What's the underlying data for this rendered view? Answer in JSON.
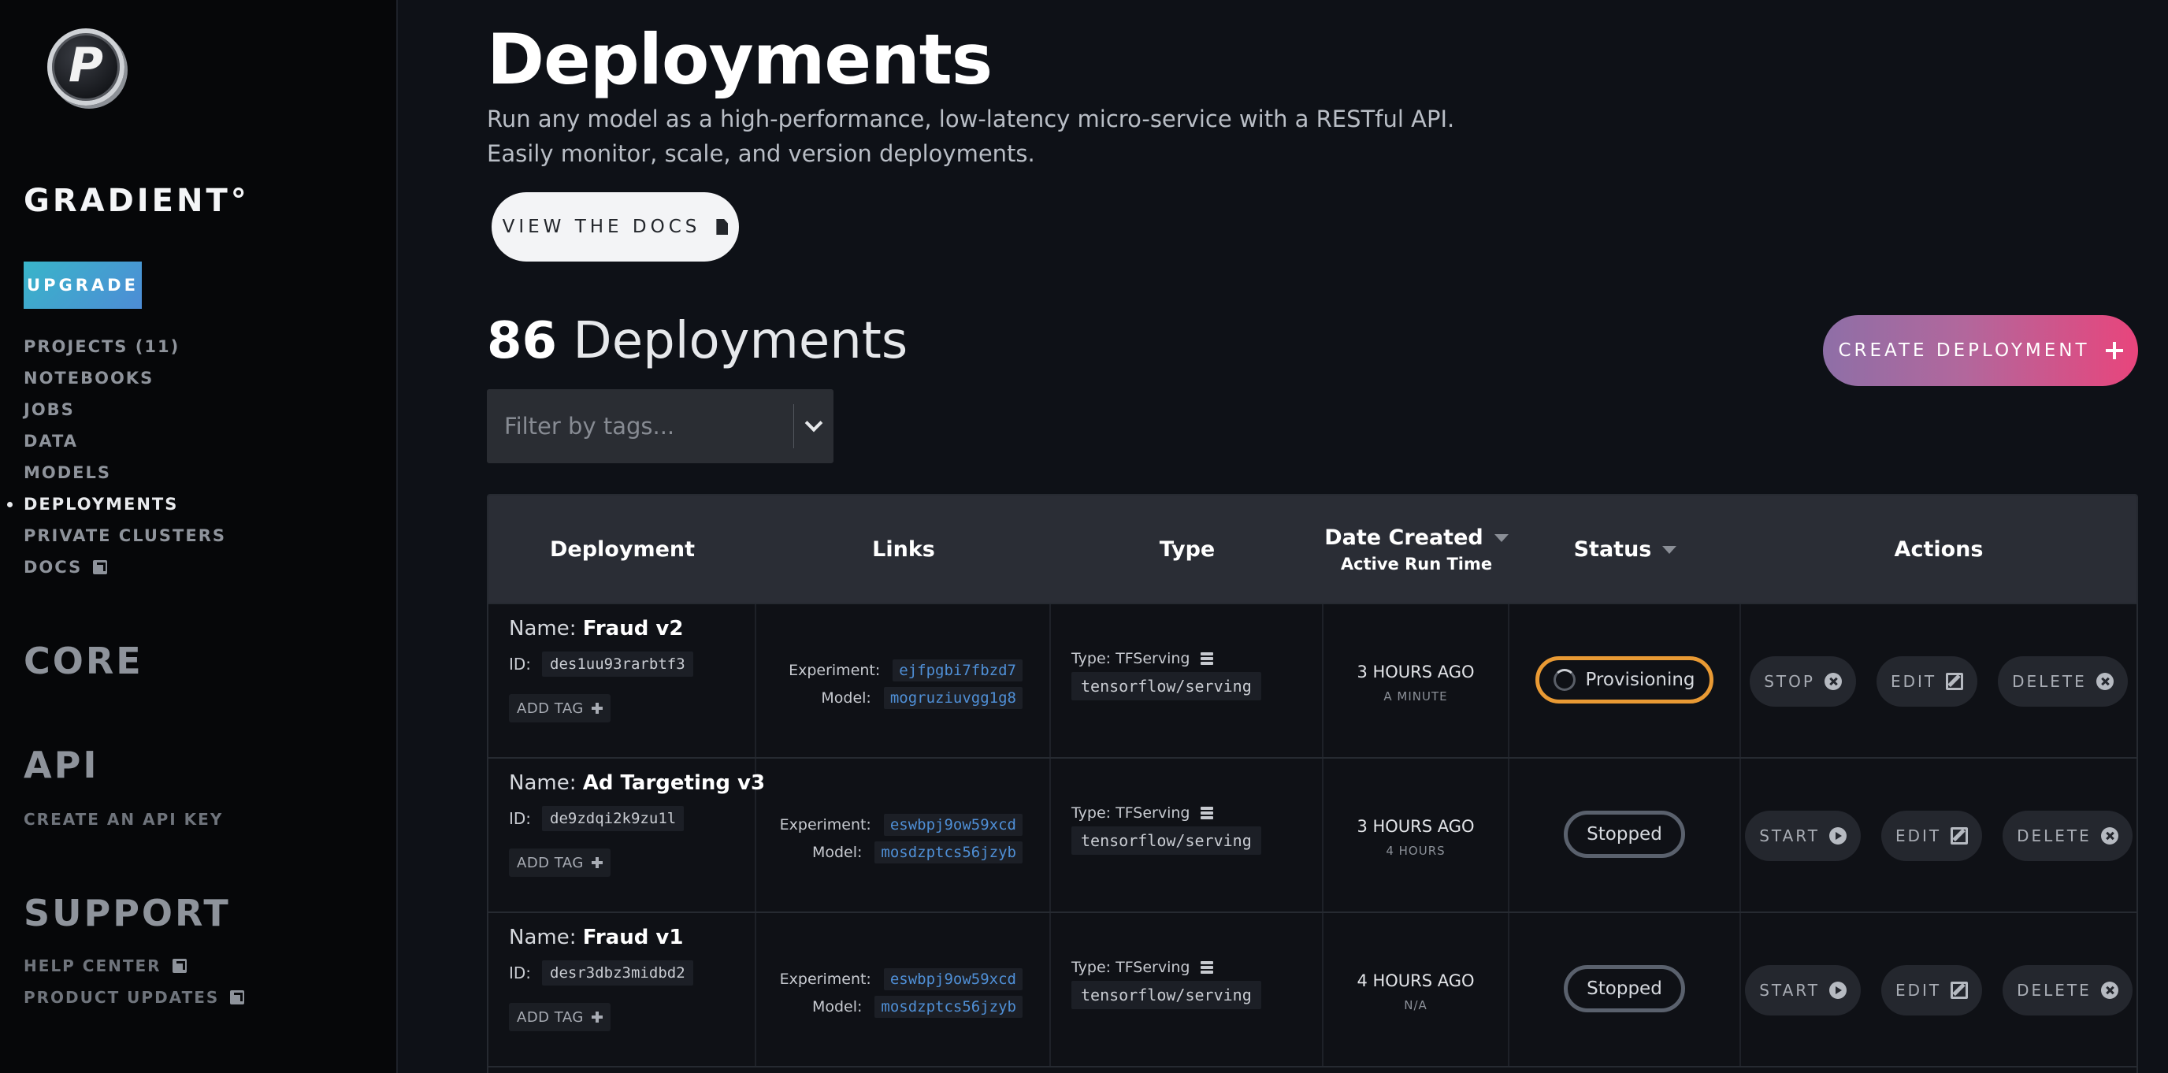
{
  "sidebar": {
    "logo_letter": "P",
    "brand": "GRADIENT°",
    "upgrade_label": "UPGRADE",
    "nav": [
      {
        "label": "PROJECTS (11)",
        "active": false,
        "external": false
      },
      {
        "label": "NOTEBOOKS",
        "active": false,
        "external": false
      },
      {
        "label": "JOBS",
        "active": false,
        "external": false
      },
      {
        "label": "DATA",
        "active": false,
        "external": false
      },
      {
        "label": "MODELS",
        "active": false,
        "external": false
      },
      {
        "label": "DEPLOYMENTS",
        "active": true,
        "external": false
      },
      {
        "label": "PRIVATE CLUSTERS",
        "active": false,
        "external": false
      },
      {
        "label": "DOCS",
        "active": false,
        "external": true
      }
    ],
    "core_title": "CORE",
    "api_title": "API",
    "api_link": "CREATE AN API KEY",
    "support_title": "SUPPORT",
    "support_links": [
      "HELP CENTER",
      "PRODUCT UPDATES"
    ]
  },
  "main": {
    "title": "Deployments",
    "subtitle_line1": "Run any model as a high-performance, low-latency micro-service with a RESTful API.",
    "subtitle_line2": "Easily monitor, scale, and version deployments.",
    "docs_button": "VIEW THE DOCS",
    "count_number": "86",
    "count_label": "Deployments",
    "create_button": "CREATE DEPLOYMENT",
    "filter_placeholder": "Filter by tags..."
  },
  "table": {
    "headers": {
      "deployment": "Deployment",
      "links": "Links",
      "type": "Type",
      "date_created": "Date Created",
      "date_sub": "Active Run Time",
      "status": "Status",
      "actions": "Actions"
    },
    "labels": {
      "name": "Name:",
      "id": "ID:",
      "add_tag": "ADD TAG",
      "experiment": "Experiment:",
      "model": "Model:",
      "type": "Type:",
      "stop": "STOP",
      "start": "START",
      "edit": "EDIT",
      "delete": "DELETE"
    },
    "rows": [
      {
        "name": "Fraud v2",
        "id": "des1uu93rarbtf3",
        "experiment": "ejfpgbi7fbzd7",
        "model": "mogruziuvgg1g8",
        "type": "TFServing",
        "image": "tensorflow/serving",
        "date": "3 HOURS AGO",
        "runtime": "A MINUTE",
        "status": "Provisioning",
        "primary_action": "STOP"
      },
      {
        "name": "Ad Targeting v3",
        "id": "de9zdqi2k9zu1l",
        "experiment": "eswbpj9ow59xcd",
        "model": "mosdzptcs56jzyb",
        "type": "TFServing",
        "image": "tensorflow/serving",
        "date": "3 HOURS AGO",
        "runtime": "4 HOURS",
        "status": "Stopped",
        "primary_action": "START"
      },
      {
        "name": "Fraud v1",
        "id": "desr3dbz3midbd2",
        "experiment": "eswbpj9ow59xcd",
        "model": "mosdzptcs56jzyb",
        "type": "TFServing",
        "image": "tensorflow/serving",
        "date": "4 HOURS AGO",
        "runtime": "N/A",
        "status": "Stopped",
        "primary_action": "START"
      }
    ]
  },
  "colors": {
    "background": "#0e1117",
    "sidebar": "#060709",
    "upgrade_gradient_start": "#39b5c9",
    "create_gradient_start": "#8e6fa7",
    "create_gradient_end": "#e8457c",
    "provisioning": "#e99a34",
    "stopped": "#5a616d",
    "link": "#4f8fd6"
  },
  "icons": {
    "docs": "document-icon",
    "external": "external-link-icon",
    "create": "plus-icon",
    "filter": "chevron-down-icon",
    "type": "database-icon",
    "stop": "close-circle-icon",
    "start": "play-circle-icon",
    "edit": "edit-icon",
    "delete": "close-circle-icon",
    "sort": "caret-down-icon"
  }
}
